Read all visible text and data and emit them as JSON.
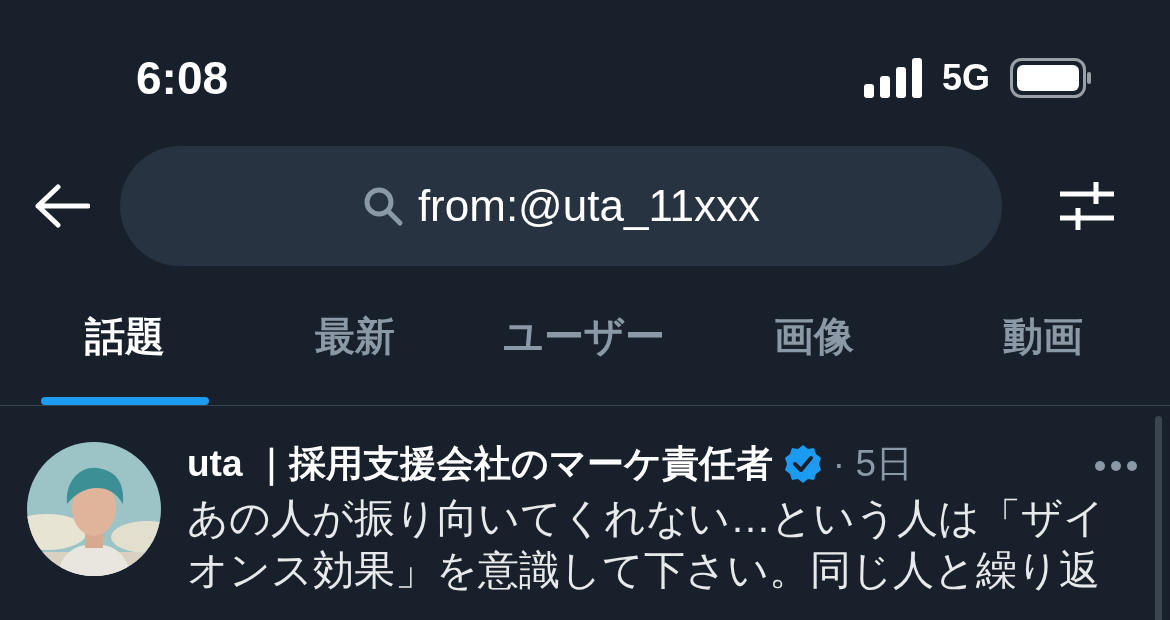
{
  "status_bar": {
    "time": "6:08",
    "network": "5G"
  },
  "search": {
    "value": "from:@uta_11xxx"
  },
  "tabs": [
    {
      "label": "話題",
      "selected": true
    },
    {
      "label": "最新",
      "selected": false
    },
    {
      "label": "ユーザー",
      "selected": false
    },
    {
      "label": "画像",
      "selected": false
    },
    {
      "label": "動画",
      "selected": false
    }
  ],
  "tweet": {
    "name": "uta ｜採用支援会社のマーケ責任者",
    "verified": true,
    "time": "· 5日",
    "text": "あの人が振り向いてくれない…という人は「ザイオンス効果」を意識して下さい。同じ人と繰り返"
  }
}
